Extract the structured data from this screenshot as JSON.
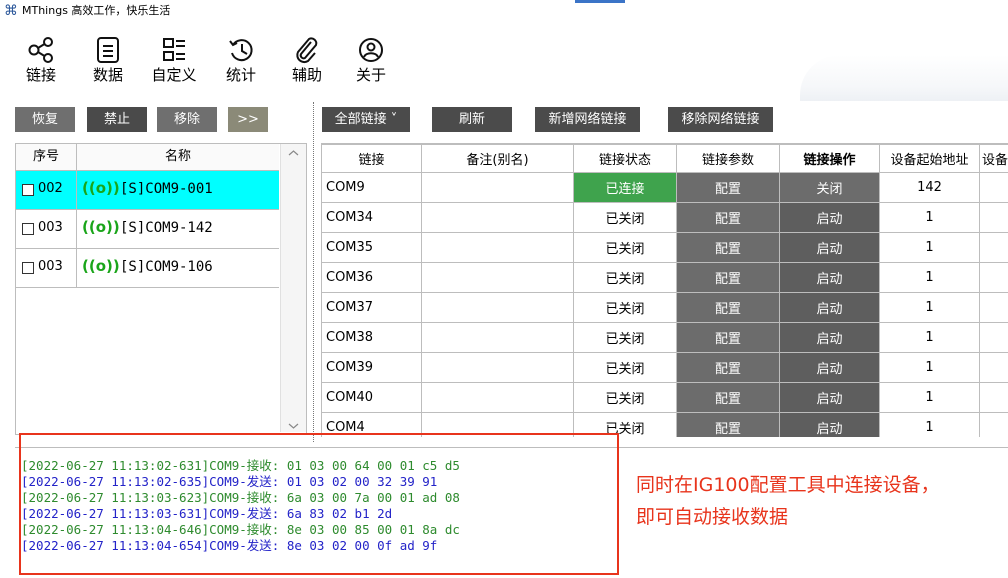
{
  "title": {
    "app_icon": "⌘",
    "text": "MThings  高效工作，快乐生活"
  },
  "toolbar": [
    {
      "name": "link-icon",
      "label": "链接"
    },
    {
      "name": "data-icon",
      "label": "数据"
    },
    {
      "name": "custom-icon",
      "label": "自定义"
    },
    {
      "name": "stats-icon",
      "label": "统计"
    },
    {
      "name": "assist-icon",
      "label": "辅助"
    },
    {
      "name": "about-icon",
      "label": "关于"
    }
  ],
  "left_buttons": {
    "restore": "恢复",
    "disable": "禁止",
    "remove": "移除",
    "more": ">>"
  },
  "left_list": {
    "headers": {
      "index": "序号",
      "name": "名称"
    },
    "rows": [
      {
        "index": "002",
        "name": "[S]COM9-001",
        "signal": "((o))"
      },
      {
        "index": "003",
        "name": "[S]COM9-142",
        "signal": "((o))"
      },
      {
        "index": "003",
        "name": "[S]COM9-106",
        "signal": "((o))"
      }
    ]
  },
  "right_buttons": {
    "all_links": "全部链接 ˅",
    "refresh": "刷新",
    "add_network": "新增网络链接",
    "remove_network": "移除网络链接"
  },
  "table": {
    "headers": [
      "链接",
      "备注(别名)",
      "链接状态",
      "链接参数",
      "链接操作",
      "设备起始地址",
      "设备"
    ],
    "rows": [
      {
        "link": "COM9",
        "note": "",
        "status": "已连接",
        "param": "配置",
        "op": "关闭",
        "addr": "142"
      },
      {
        "link": "COM34",
        "note": "",
        "status": "已关闭",
        "param": "配置",
        "op": "启动",
        "addr": "1"
      },
      {
        "link": "COM35",
        "note": "",
        "status": "已关闭",
        "param": "配置",
        "op": "启动",
        "addr": "1"
      },
      {
        "link": "COM36",
        "note": "",
        "status": "已关闭",
        "param": "配置",
        "op": "启动",
        "addr": "1"
      },
      {
        "link": "COM37",
        "note": "",
        "status": "已关闭",
        "param": "配置",
        "op": "启动",
        "addr": "1"
      },
      {
        "link": "COM38",
        "note": "",
        "status": "已关闭",
        "param": "配置",
        "op": "启动",
        "addr": "1"
      },
      {
        "link": "COM39",
        "note": "",
        "status": "已关闭",
        "param": "配置",
        "op": "启动",
        "addr": "1"
      },
      {
        "link": "COM40",
        "note": "",
        "status": "已关闭",
        "param": "配置",
        "op": "启动",
        "addr": "1"
      },
      {
        "link": "COM4",
        "note": "",
        "status": "已关闭",
        "param": "配置",
        "op": "启动",
        "addr": "1"
      }
    ]
  },
  "log": [
    {
      "type": "recv",
      "text": "[2022-06-27 11:13:02-631]COM9-接收: 01 03 00 64 00 01 c5 d5"
    },
    {
      "type": "send",
      "text": "[2022-06-27 11:13:02-635]COM9-发送: 01 03 02 00 32 39 91"
    },
    {
      "type": "recv",
      "text": "[2022-06-27 11:13:03-623]COM9-接收: 6a 03 00 7a 00 01 ad 08"
    },
    {
      "type": "send",
      "text": "[2022-06-27 11:13:03-631]COM9-发送: 6a 83 02 b1 2d"
    },
    {
      "type": "recv",
      "text": "[2022-06-27 11:13:04-646]COM9-接收: 8e 03 00 85 00 01 8a dc"
    },
    {
      "type": "send",
      "text": "[2022-06-27 11:13:04-654]COM9-发送: 8e 03 02 00 0f ad 9f"
    }
  ],
  "annotation": {
    "line1": "同时在IG100配置工具中连接设备，",
    "line2": "即可自动接收数据"
  },
  "colors": {
    "connected": "#3fa34d",
    "selected_row": "#00ffff",
    "annotation_red": "#e8341c",
    "recv": "#2e8b2e",
    "send": "#2323c8"
  }
}
